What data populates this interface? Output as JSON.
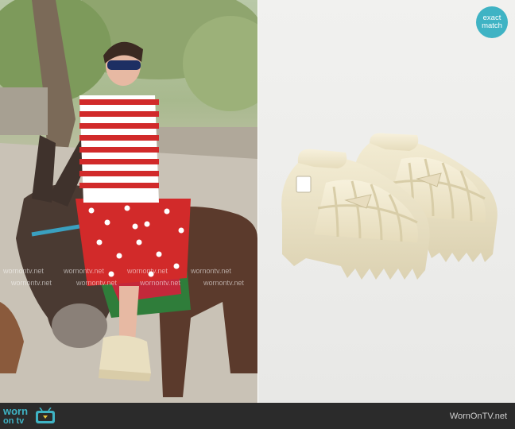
{
  "badge": {
    "line1": "exact",
    "line2": "match"
  },
  "footer": {
    "logo_line1": "worn",
    "logo_line2": "on tv",
    "site": "WornOnTV.net"
  },
  "watermark": {
    "text": "wornontv.net"
  }
}
